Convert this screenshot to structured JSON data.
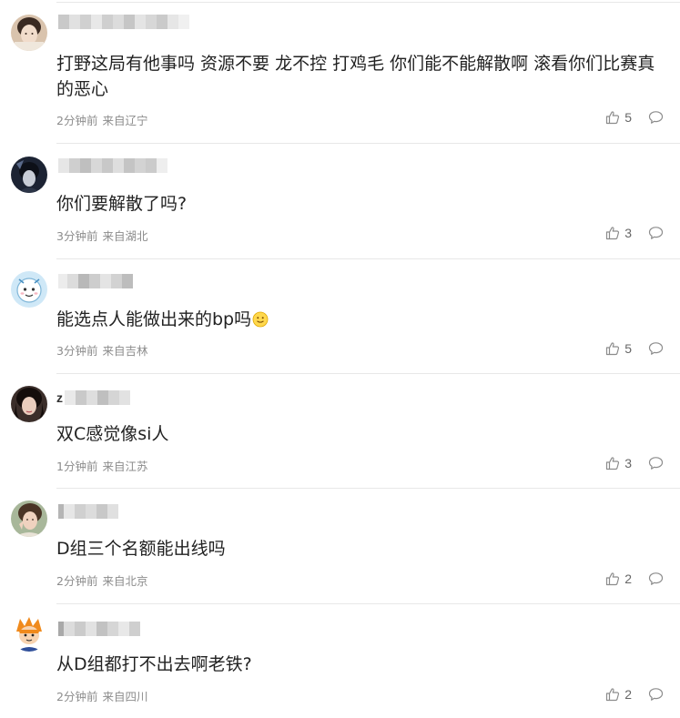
{
  "comments": [
    {
      "username_initial": "",
      "text": "打野这局有他事吗 资源不要 龙不控 打鸡毛 你们能不能解散啊 滚看你们比赛真的恶心",
      "time": "2分钟前",
      "location": "来自辽宁",
      "likes": "5"
    },
    {
      "username_initial": "",
      "text": "你们要解散了吗?",
      "time": "3分钟前",
      "location": "来自湖北",
      "likes": "3"
    },
    {
      "username_initial": "",
      "text": "能选点人能做出来的bp吗",
      "time": "3分钟前",
      "location": "来自吉林",
      "likes": "5"
    },
    {
      "username_initial": "z",
      "text": "双C感觉像si人",
      "time": "1分钟前",
      "location": "来自江苏",
      "likes": "3"
    },
    {
      "username_initial": "",
      "text": "D组三个名额能出线吗",
      "time": "2分钟前",
      "location": "来自北京",
      "likes": "2"
    },
    {
      "username_initial": "",
      "text": "从D组都打不出去啊老铁?",
      "time": "2分钟前",
      "location": "来自四川",
      "likes": "2"
    }
  ],
  "colors": {
    "text": "#222222",
    "meta": "#8c8c8c",
    "divider": "#e8e8e8"
  },
  "icons": {
    "like": "thumbs-up-icon",
    "reply": "comment-bubble-icon",
    "emoji": "smile-emoji"
  }
}
